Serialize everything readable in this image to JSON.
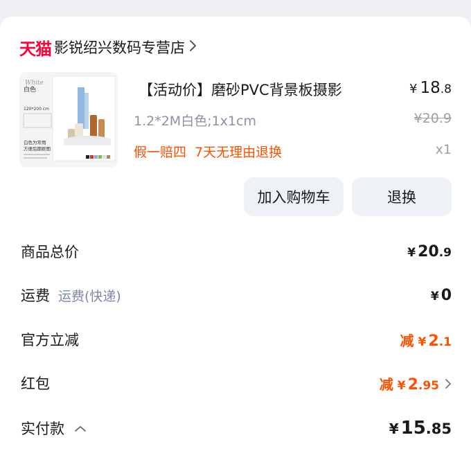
{
  "shop": {
    "brand": "天猫",
    "name": "影锐绍兴数码专营店"
  },
  "product": {
    "title": "【活动价】磨砂PVC背景板摄影",
    "price_currency": "¥",
    "price_int": "18",
    "price_dec": ".8",
    "spec": "1.2*2M白色;1x1cm",
    "original_price": "¥20.9",
    "services": "假一赔四 7天无理由退换",
    "quantity": "x1",
    "thumb": {
      "brand": "White",
      "color": "白色",
      "size": "120*200 cm",
      "tagline1": "白色为常用",
      "tagline2": "方便后期抠图"
    }
  },
  "buttons": {
    "add_cart": "加入购物车",
    "return": "退换"
  },
  "summary": {
    "goods_total": {
      "label": "商品总价",
      "cur": "¥",
      "int": "20",
      "dec": ".9"
    },
    "shipping": {
      "label": "运费",
      "sub": "运费(快递)",
      "cur": "¥",
      "int": "0",
      "dec": ""
    },
    "discount": {
      "label": "官方立减",
      "prefix": "减",
      "cur": "¥",
      "int": "2",
      "dec": ".1"
    },
    "red_packet": {
      "label": "红包",
      "prefix": "减",
      "cur": "¥",
      "int": "2",
      "dec": ".95"
    },
    "paid": {
      "label": "实付款",
      "cur": "¥",
      "int": "15",
      "dec": ".85"
    }
  },
  "colors": {
    "accent": "#ff5000",
    "tmall": "#ff0036",
    "muted": "#8a93a5",
    "button_bg": "#eef1f5"
  }
}
